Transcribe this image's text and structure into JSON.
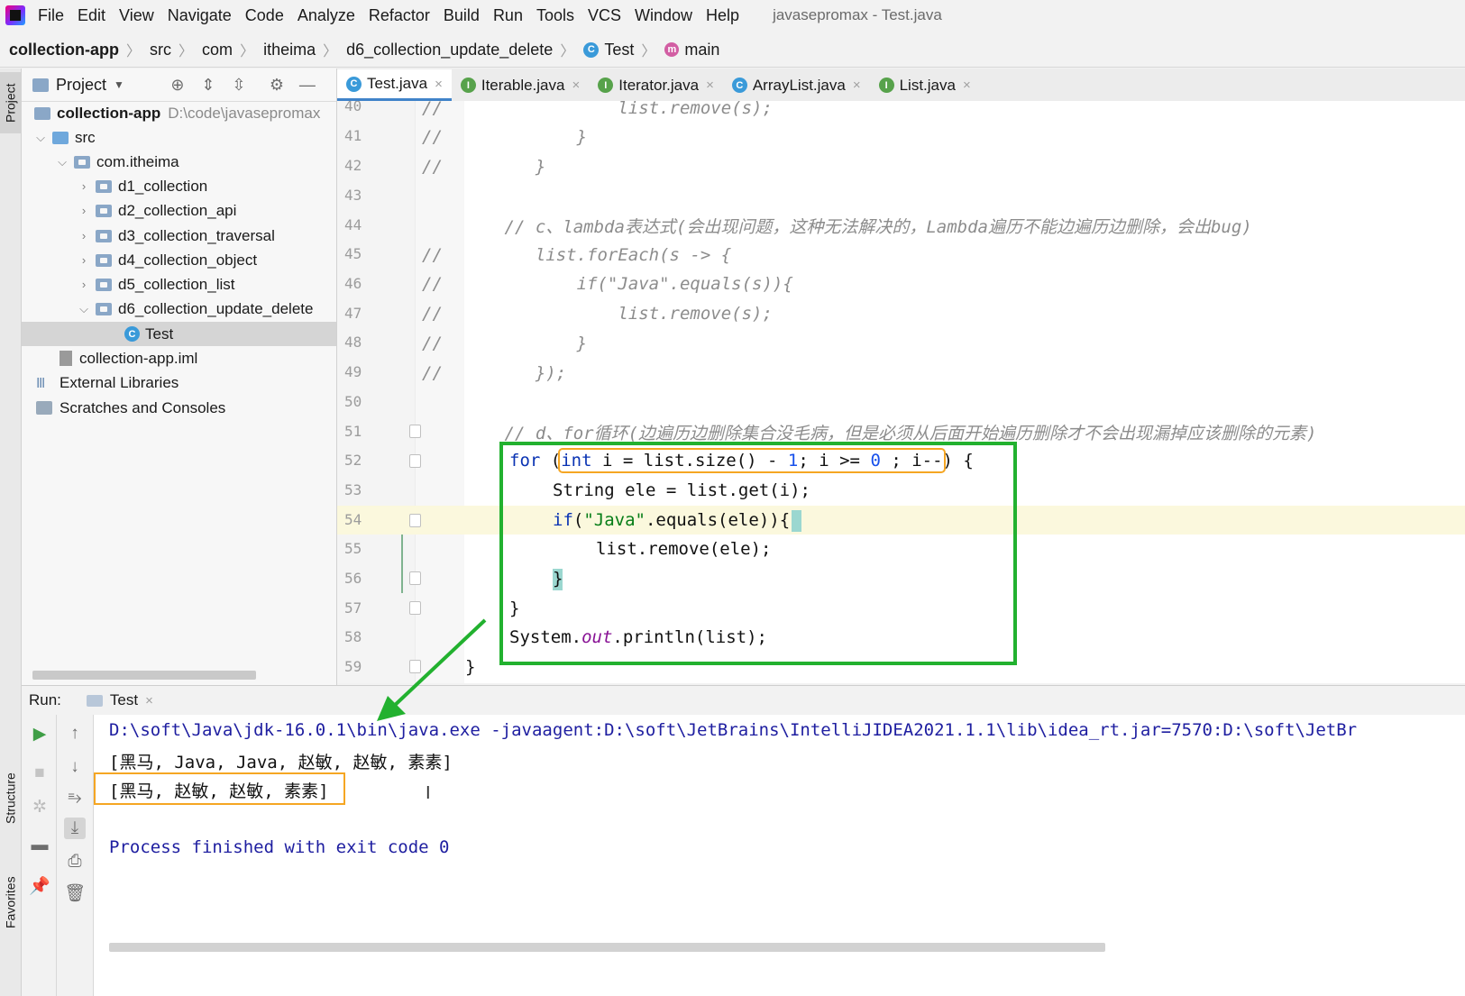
{
  "menubar": {
    "items": [
      "File",
      "Edit",
      "View",
      "Navigate",
      "Code",
      "Analyze",
      "Refactor",
      "Build",
      "Run",
      "Tools",
      "VCS",
      "Window",
      "Help"
    ],
    "title": "javasepromax - Test.java"
  },
  "breadcrumb": [
    "collection-app",
    "src",
    "com",
    "itheima",
    "d6_collection_update_delete",
    "Test",
    "main"
  ],
  "stripe": {
    "project": "Project",
    "structure": "Structure",
    "favorites": "Favorites"
  },
  "project": {
    "title": "Project",
    "root_name": "collection-app",
    "root_path": "D:\\code\\javasepromax",
    "src": "src",
    "package": "com.itheima",
    "folders": [
      "d1_collection",
      "d2_collection_api",
      "d3_collection_traversal",
      "d4_collection_object",
      "d5_collection_list",
      "d6_collection_update_delete"
    ],
    "selected_file": "Test",
    "iml": "collection-app.iml",
    "external_libraries": "External Libraries",
    "scratches": "Scratches and Consoles"
  },
  "tabs": [
    {
      "label": "Test.java",
      "kind": "C",
      "active": true
    },
    {
      "label": "Iterable.java",
      "kind": "I"
    },
    {
      "label": "Iterator.java",
      "kind": "I"
    },
    {
      "label": "ArrayList.java",
      "kind": "C"
    },
    {
      "label": "List.java",
      "kind": "I"
    }
  ],
  "editor": {
    "line_numbers": [
      "40",
      "41",
      "42",
      "43",
      "44",
      "45",
      "46",
      "47",
      "48",
      "49",
      "50",
      "51",
      "52",
      "53",
      "54",
      "55",
      "56",
      "57",
      "58",
      "59"
    ],
    "current_line": "54",
    "code": {
      "l40": "//                 list.remove(s);",
      "l41": "//             }",
      "l42": "//         }",
      "l44": "        // c、lambda表达式(会出现问题，这种无法解决的，Lambda遍历不能边遍历边删除，会出bug)",
      "l45": "//         list.forEach(s -> {",
      "l46": "//             if(\"Java\".equals(s)){",
      "l47": "//                 list.remove(s);",
      "l48": "//             }",
      "l49": "//         });",
      "l51": "        // d、for循环(边遍历边删除集合没毛病，但是必须从后面开始遍历删除才不会出现漏掉应该删除的元素)",
      "l52_kw": "for",
      "l52_open": "(",
      "l52_int": "int",
      "l52_a": " i = list.size() - ",
      "l52_one": "1",
      "l52_b": "; i >= ",
      "l52_zero": "0",
      "l52_c": " ; i--",
      "l52_end": ") {",
      "l53": "String ele = list.get(i);",
      "l54_kw": "if",
      "l54_a": "(",
      "l54_str": "\"Java\"",
      "l54_b": ".equals(ele)){",
      "l55": "list.remove(ele);",
      "l56": "}",
      "l57": "}",
      "l58_a": "System.",
      "l58_out": "out",
      "l58_b": ".println(list);",
      "l59": "}"
    }
  },
  "run": {
    "label": "Run:",
    "tab": "Test",
    "console": [
      "D:\\soft\\Java\\jdk-16.0.1\\bin\\java.exe -javaagent:D:\\soft\\JetBrains\\IntelliJIDEA2021.1.1\\lib\\idea_rt.jar=7570:D:\\soft\\JetBr",
      "[黑马, Java, Java, 赵敏, 赵敏, 素素]",
      "[黑马, 赵敏, 赵敏, 素素]",
      "",
      "Process finished with exit code 0"
    ]
  },
  "colors": {
    "green_box": "#22b12f",
    "orange_box": "#f5a623",
    "tab_underline": "#4083c9",
    "console_text": "#1e1ea0"
  }
}
